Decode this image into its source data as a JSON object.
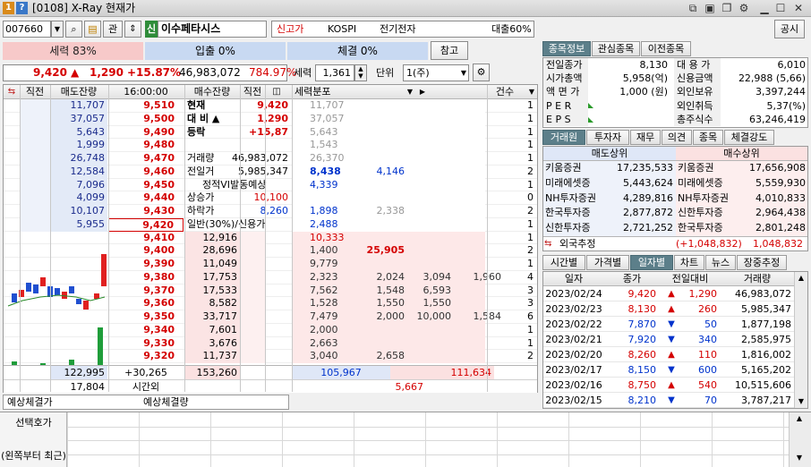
{
  "window": {
    "badge1": "1",
    "badge2": "?",
    "title": "[0108] X-Ray 현재가",
    "win_icons": [
      "layout-icon",
      "save-icon",
      "copy-icon",
      "gear-icon",
      "minimize-icon",
      "maximize-icon",
      "close-icon"
    ]
  },
  "toolbar": {
    "code": "007660",
    "kwan_label": "관",
    "sin_badge": "신",
    "stock_name": "이수페타시스",
    "new_high": "신고가",
    "market": "KOSPI",
    "sector": "전기전자",
    "loan": "대출60%",
    "public_label": "공시"
  },
  "ratio": {
    "sell": "세력 83%",
    "ipchul": "입출 0%",
    "che": "체결 0%",
    "ref_label": "참고"
  },
  "quote": {
    "price": "9,420",
    "arrow": "▲",
    "change": "1,290",
    "rate": "+15.87%",
    "volume": "46,983,072",
    "vol_ratio": "784.97%"
  },
  "options": {
    "force_label": "세력",
    "force_value": "1,361",
    "unit_label": "단위",
    "unit_value": "1(주)"
  },
  "hoga": {
    "headers": {
      "prev": "직전",
      "sell_rem": "매도잔량",
      "time": "16:00:00",
      "buy_rem": "매수잔량",
      "prev2": "직전",
      "dist": "세력분포",
      "count": "건수"
    },
    "asks": [
      {
        "rem": "11,707",
        "price": "9,510",
        "dist": [
          "11,707",
          "",
          "",
          "",
          ""
        ],
        "cnt": "1"
      },
      {
        "rem": "37,057",
        "price": "9,500",
        "dist": [
          "37,057",
          "",
          "",
          "",
          ""
        ],
        "cnt": "1"
      },
      {
        "rem": "5,643",
        "price": "9,490",
        "dist": [
          "5,643",
          "",
          "",
          "",
          ""
        ],
        "cnt": "1"
      },
      {
        "rem": "1,999",
        "price": "9,480",
        "dist": [
          "1,543",
          "",
          "",
          "",
          ""
        ],
        "cnt": "1"
      },
      {
        "rem": "26,748",
        "price": "9,470",
        "dist": [
          "26,370",
          "",
          "",
          "",
          ""
        ],
        "cnt": "1"
      },
      {
        "rem": "12,584",
        "price": "9,460",
        "dist": [
          "8,438",
          "4,146",
          "",
          "",
          ""
        ],
        "cnt": "2"
      },
      {
        "rem": "7,096",
        "price": "9,450",
        "dist": [
          "4,339",
          "",
          "",
          "",
          ""
        ],
        "cnt": "1"
      },
      {
        "rem": "4,099",
        "price": "9,440",
        "dist": [
          "",
          "",
          "",
          "",
          ""
        ],
        "cnt": "0"
      },
      {
        "rem": "10,107",
        "price": "9,430",
        "dist": [
          "1,898",
          "2,338",
          "",
          "",
          ""
        ],
        "cnt": "2"
      },
      {
        "rem": "5,955",
        "price": "9,420",
        "dist": [
          "2,488",
          "",
          "",
          "",
          ""
        ],
        "cnt": "1"
      }
    ],
    "bids": [
      {
        "rem": "12,916",
        "price": "9,410",
        "dist": [
          "10,333",
          "",
          "",
          "",
          ""
        ],
        "cnt": "1"
      },
      {
        "rem": "28,696",
        "price": "9,400",
        "dist": [
          "1,400",
          "25,905",
          "",
          "",
          ""
        ],
        "cnt": "2"
      },
      {
        "rem": "11,049",
        "price": "9,390",
        "dist": [
          "9,779",
          "",
          "",
          "",
          ""
        ],
        "cnt": "1"
      },
      {
        "rem": "17,753",
        "price": "9,380",
        "dist": [
          "2,323",
          "2,024",
          "3,094",
          "1,960",
          ""
        ],
        "cnt": "4"
      },
      {
        "rem": "17,533",
        "price": "9,370",
        "dist": [
          "7,562",
          "1,548",
          "6,593",
          "",
          ""
        ],
        "cnt": "3"
      },
      {
        "rem": "8,582",
        "price": "9,360",
        "dist": [
          "1,528",
          "1,550",
          "1,550",
          "",
          ""
        ],
        "cnt": "3"
      },
      {
        "rem": "33,717",
        "price": "9,350",
        "dist": [
          "7,479",
          "2,000",
          "10,000",
          "1,584",
          ""
        ],
        "cnt": "6"
      },
      {
        "rem": "7,601",
        "price": "9,340",
        "dist": [
          "2,000",
          "",
          "",
          "",
          ""
        ],
        "cnt": "1"
      },
      {
        "rem": "3,676",
        "price": "9,330",
        "dist": [
          "2,663",
          "",
          "",
          "",
          ""
        ],
        "cnt": "1"
      },
      {
        "rem": "11,737",
        "price": "9,320",
        "dist": [
          "3,040",
          "2,658",
          "",
          "",
          ""
        ],
        "cnt": "2"
      }
    ],
    "info": [
      {
        "label": "현재",
        "value": "9,420"
      },
      {
        "label": "대  비 ▲",
        "value": "1,290"
      },
      {
        "label": "등락",
        "value": "+15,87"
      },
      {
        "label": "",
        "value": ""
      },
      {
        "label": "거래량",
        "value": "46,983,072"
      },
      {
        "label": "전일거",
        "value": "5,985,347"
      },
      {
        "label": "정적VI발동예상",
        "value": ""
      },
      {
        "label": "상승가",
        "value": "10,100"
      },
      {
        "label": "하락가",
        "value": "8,260"
      },
      {
        "label": "일반(30%)/신용가",
        "value": ""
      }
    ],
    "total_sell": "122,995",
    "diff": "+30,265",
    "total_buy": "153,260",
    "sell_after": "17,804",
    "after_label": "시간외",
    "dist_total_sell": "105,967",
    "dist_total_buy": "111,634",
    "dist_total2": "5,667",
    "expect_label": "예상체결가",
    "expect_vol_label": "예상체결량"
  },
  "info_tabs": [
    "종목정보",
    "관심종목",
    "이전종목"
  ],
  "stock_info": {
    "left": [
      [
        "전일종가",
        "8,130"
      ],
      [
        "시가총액",
        "5,958(억)"
      ],
      [
        "액 면 가",
        "1,000 (원)"
      ],
      [
        "P E R",
        ""
      ],
      [
        "E P S",
        ""
      ]
    ],
    "right": [
      [
        "대 용 가",
        "6,010"
      ],
      [
        "신용금액",
        "22,988  (5,66)"
      ],
      [
        "외인보유",
        "3,397,244"
      ],
      [
        "외인취득",
        "5,37(%)"
      ],
      [
        "총주식수",
        "63,246,419"
      ]
    ]
  },
  "broker_tabs": [
    "거래원",
    "투자자",
    "재무",
    "의견",
    "종목",
    "체결강도"
  ],
  "broker": {
    "sell_header": "매도상위",
    "buy_header": "매수상위",
    "rows": [
      [
        "키움증권",
        "17,235,533",
        "키움증권",
        "17,656,908"
      ],
      [
        "미래에셋증",
        "5,443,624",
        "미래에셋증",
        "5,559,930"
      ],
      [
        "NH투자증권",
        "4,289,816",
        "NH투자증권",
        "4,010,833"
      ],
      [
        "한국투자증",
        "2,877,872",
        "신한투자증",
        "2,964,438"
      ],
      [
        "신한투자증",
        "2,721,252",
        "한국투자증",
        "2,801,248"
      ]
    ],
    "foreign_label": "외국추정",
    "foreign_diff": "(+1,048,832)",
    "foreign_value": "1,048,832"
  },
  "daily_tabs": [
    "시간별",
    "가격별",
    "일자별",
    "차트",
    "뉴스",
    "장중추정"
  ],
  "daily": {
    "headers": [
      "일자",
      "종가",
      "전일대비",
      "거래량"
    ],
    "rows": [
      {
        "date": "2023/02/24",
        "close": "9,420",
        "dir": "▲",
        "chg": "1,290",
        "vol": "46,983,072"
      },
      {
        "date": "2023/02/23",
        "close": "8,130",
        "dir": "▲",
        "chg": "260",
        "vol": "5,985,347"
      },
      {
        "date": "2023/02/22",
        "close": "7,870",
        "dir": "▼",
        "chg": "50",
        "vol": "1,877,198"
      },
      {
        "date": "2023/02/21",
        "close": "7,920",
        "dir": "▼",
        "chg": "340",
        "vol": "2,585,975"
      },
      {
        "date": "2023/02/20",
        "close": "8,260",
        "dir": "▲",
        "chg": "110",
        "vol": "1,816,002"
      },
      {
        "date": "2023/02/17",
        "close": "8,150",
        "dir": "▼",
        "chg": "600",
        "vol": "5,165,202"
      },
      {
        "date": "2023/02/16",
        "close": "8,750",
        "dir": "▲",
        "chg": "540",
        "vol": "10,515,606"
      },
      {
        "date": "2023/02/15",
        "close": "8,210",
        "dir": "▼",
        "chg": "70",
        "vol": "3,787,217"
      }
    ]
  },
  "bottom": {
    "select_label": "선택호가",
    "order_label": "(왼쪽부터 최근)"
  },
  "colors": {
    "red": "#d40000",
    "blue": "#0033cc",
    "ask_bg": "#e9eef8",
    "bid_bg": "#fbe7e7",
    "tab_active": "#5c7f8a"
  }
}
